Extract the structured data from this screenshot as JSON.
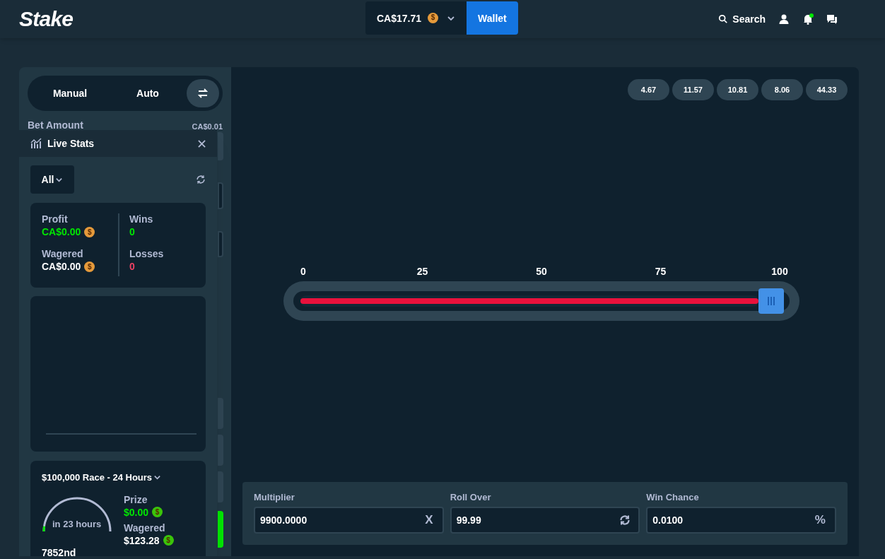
{
  "header": {
    "logo": "Stake",
    "balance": "CA$17.71",
    "coin": {
      "symbol": "$",
      "color": "#e59a3b"
    },
    "wallet_button": "Wallet",
    "search": "Search",
    "notification_dot": true
  },
  "sidebar": {
    "mode_tabs": [
      {
        "label": "Manual"
      },
      {
        "label": "Auto"
      }
    ],
    "bet_amount_label": "Bet Amount",
    "bet_amount_value": "CA$0.01"
  },
  "live_stats": {
    "title": "Live Stats",
    "filter": "All",
    "stats": [
      {
        "label": "Profit",
        "value": "CA$0.00",
        "color": "#00e701",
        "coin": {
          "symbol": "$",
          "color": "#e59a3b"
        }
      },
      {
        "label": "Wins",
        "value": "0",
        "color": "#00e701"
      },
      {
        "label": "Wagered",
        "value": "CA$0.00",
        "color": "#ffffff",
        "coin": {
          "symbol": "$",
          "color": "#e59a3b"
        }
      },
      {
        "label": "Losses",
        "value": "0",
        "color": "#ed4163"
      }
    ]
  },
  "race": {
    "title": "$100,000 Race - 24 Hours",
    "countdown": "in 23 hours",
    "level": 0.05,
    "rank": "7852nd",
    "stats": [
      {
        "label": "Prize",
        "value": "$0.00",
        "color": "#00e701",
        "coin": {
          "symbol": "$",
          "color": "#3ac40a"
        }
      },
      {
        "label": "Wagered",
        "value": "$123.28",
        "color": "#ffffff",
        "coin": {
          "symbol": "$",
          "color": "#3ac40a"
        }
      }
    ]
  },
  "game": {
    "recent_results": [
      "4.67",
      "11.57",
      "10.81",
      "8.06",
      "44.33"
    ],
    "slider": {
      "ticks": [
        "0",
        "25",
        "50",
        "75",
        "100"
      ],
      "level": 0.9999
    },
    "fields": [
      {
        "label": "Multiplier",
        "value": "9900.0000",
        "kind": "text",
        "suffix": "X"
      },
      {
        "label": "Roll Over",
        "value": "99.99",
        "kind": "icon"
      },
      {
        "label": "Win Chance",
        "value": "0.0100",
        "kind": "text",
        "suffix": "%"
      }
    ]
  }
}
